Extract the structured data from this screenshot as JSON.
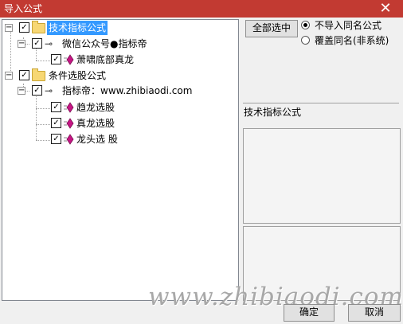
{
  "window": {
    "title": "导入公式",
    "close_symbol": "✕"
  },
  "tree": {
    "checkmark": "✓",
    "expand_symbol": "−",
    "key_symbol": "⊸",
    "nodes": [
      {
        "label": "技术指标公式",
        "checked": true,
        "selected": true,
        "type": "folder"
      },
      {
        "label": "微信公众号●指标帝",
        "checked": true,
        "type": "group"
      },
      {
        "label": "萧啸底部真龙",
        "checked": true,
        "type": "formula"
      },
      {
        "label": "条件选股公式",
        "checked": true,
        "type": "folder"
      },
      {
        "label": "指标帝：www.zhibiaodi.com",
        "checked": true,
        "type": "group"
      },
      {
        "label": "趋龙选股",
        "checked": true,
        "type": "formula"
      },
      {
        "label": "真龙选股",
        "checked": true,
        "type": "formula"
      },
      {
        "label": "龙头选 股",
        "checked": true,
        "type": "formula"
      }
    ]
  },
  "options": {
    "select_all_label": "全部选中",
    "radio_no_import": "不导入同名公式",
    "radio_overwrite": "覆盖同名(非系统)",
    "selected_radio": "no_import"
  },
  "info_panel": {
    "label": "技术指标公式"
  },
  "footer": {
    "ok_label": "确定",
    "cancel_label": "取消"
  },
  "watermark": "www.zhibiaodi.com",
  "colors": {
    "titlebar": "#c23a32",
    "selection": "#3399ff",
    "formula_icon": "#c71585"
  }
}
